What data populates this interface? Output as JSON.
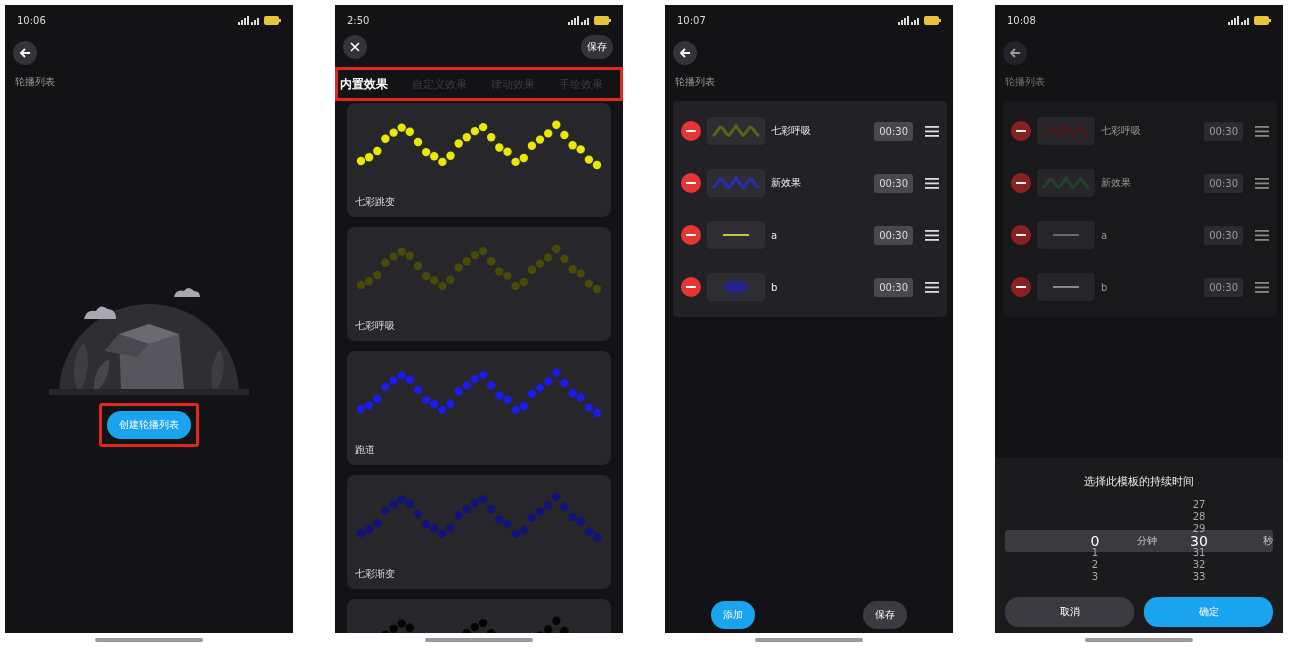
{
  "screens": [
    {
      "kind": "empty_list",
      "status_time": "10:06",
      "title": "轮播列表",
      "create_button": "创建轮播列表",
      "highlighted": true
    },
    {
      "kind": "effects",
      "status_time": "2:50",
      "save_button": "保存",
      "tabs_highlighted": true,
      "tabs": [
        {
          "label": "内置效果",
          "selected": true
        },
        {
          "label": "自定义效果",
          "selected": false
        },
        {
          "label": "律动效果",
          "selected": false
        },
        {
          "label": "手绘效果",
          "selected": false
        }
      ],
      "cards": [
        {
          "label": "七彩跳变",
          "color": "#e8e800"
        },
        {
          "label": "七彩呼吸",
          "color": "#4a4a08"
        },
        {
          "label": "跑道",
          "color": "#1c1ce8"
        },
        {
          "label": "七彩渐变",
          "color": "#12127a"
        },
        {
          "color": "#050505"
        }
      ]
    },
    {
      "kind": "playlist",
      "status_time": "10:07",
      "title": "轮播列表",
      "items": [
        {
          "name": "七彩呼吸",
          "duration": "00:30",
          "kind": "wave",
          "color": "#556414"
        },
        {
          "name": "新效果",
          "duration": "00:30",
          "kind": "wave",
          "color": "#2c2cb0"
        },
        {
          "name": "a",
          "duration": "00:30",
          "kind": "line",
          "color": "#c8c832"
        },
        {
          "name": "b",
          "duration": "00:30",
          "kind": "blob",
          "color": "#24248c"
        }
      ],
      "add_button": "添加",
      "save_button": "保存"
    },
    {
      "kind": "duration_picker",
      "status_time": "10:08",
      "title": "轮播列表",
      "items": [
        {
          "name": "七彩呼吸",
          "duration": "00:30",
          "kind": "wave",
          "color": "#4a1818"
        },
        {
          "name": "新效果",
          "duration": "00:30",
          "kind": "wave",
          "color": "#24402a"
        },
        {
          "name": "a",
          "duration": "00:30",
          "kind": "line",
          "color": "#6a6a6a"
        },
        {
          "name": "b",
          "duration": "00:30",
          "kind": "line",
          "color": "#8a8a8a"
        }
      ],
      "dialog": {
        "title": "选择此模板的持续时间",
        "minutes": [
          {
            "value": "0",
            "selected": true
          },
          {
            "value": "1",
            "selected": false
          },
          {
            "value": "2",
            "selected": false
          },
          {
            "value": "3",
            "selected": false
          }
        ],
        "minutes_unit": "分钟",
        "seconds": [
          {
            "value": "27",
            "selected": false
          },
          {
            "value": "28",
            "selected": false
          },
          {
            "value": "29",
            "selected": false
          },
          {
            "value": "30",
            "selected": true
          },
          {
            "value": "31",
            "selected": false
          },
          {
            "value": "32",
            "selected": false
          },
          {
            "value": "33",
            "selected": false
          }
        ],
        "seconds_unit": "秒",
        "cancel_button": "取消",
        "confirm_button": "确定"
      }
    }
  ]
}
